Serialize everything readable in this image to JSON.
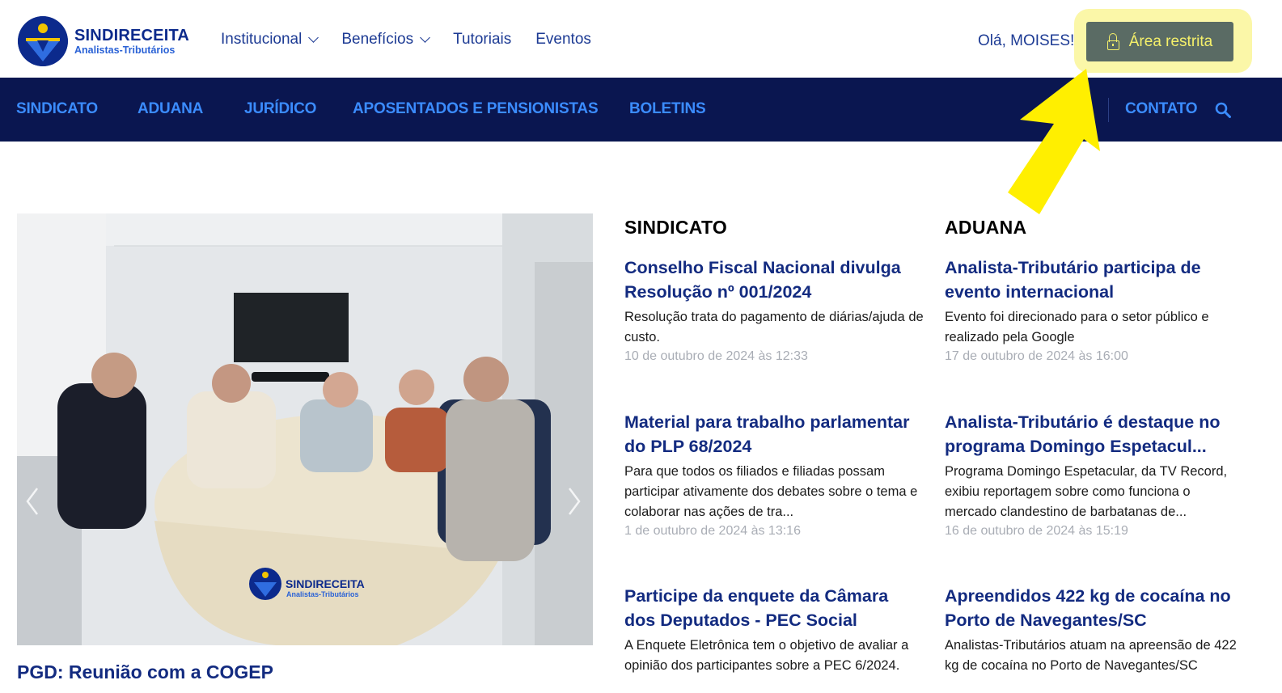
{
  "brand": {
    "name": "SINDIRECEITA",
    "tagline": "Analistas-Tributários"
  },
  "topnav": [
    {
      "label": "Institucional",
      "has_dropdown": true
    },
    {
      "label": "Benefícios",
      "has_dropdown": true
    },
    {
      "label": "Tutoriais",
      "has_dropdown": false
    },
    {
      "label": "Eventos",
      "has_dropdown": false
    }
  ],
  "user": {
    "greeting": "Olá, MOISES!",
    "restricted_label": "Área restrita"
  },
  "mainnav": [
    "SINDICATO",
    "ADUANA",
    "JURÍDICO",
    "APOSENTADOS E PENSIONISTAS",
    "BOLETINS"
  ],
  "contact_label": "CONTATO",
  "feature": {
    "title": "PGD: Reunião com a COGEP",
    "photo_brand": "SINDIRECEITA",
    "photo_tagline": "Analistas-Tributários"
  },
  "sections": [
    {
      "heading": "SINDICATO",
      "posts": [
        {
          "title": "Conselho Fiscal Nacional divulga Resolução nº 001/2024",
          "summary": "Resolução trata do pagamento de diárias/ajuda de custo.",
          "date": "10 de outubro de 2024 às 12:33"
        },
        {
          "title": "Material para trabalho parlamentar do PLP 68/2024",
          "summary": "Para que todos os filiados e filiadas possam participar ativamente dos debates sobre o tema e colaborar nas ações de tra...",
          "date": "1 de outubro de 2024 às 13:16"
        },
        {
          "title": "Participe da enquete da Câmara dos Deputados - PEC Social",
          "summary": "A Enquete Eletrônica tem o objetivo de avaliar a opinião dos participantes sobre a PEC 6/2024.",
          "date": ""
        }
      ]
    },
    {
      "heading": "ADUANA",
      "posts": [
        {
          "title": "Analista-Tributário participa de evento internacional",
          "summary": "Evento foi direcionado para o setor público e realizado pela Google",
          "date": "17 de outubro de 2024 às 16:00"
        },
        {
          "title": "Analista-Tributário é destaque no programa Domingo Espetacul...",
          "summary": "Programa Domingo Espetacular, da TV Record, exibiu reportagem sobre como funciona o mercado clandestino de barbatanas de...",
          "date": "16 de outubro de 2024 às 15:19"
        },
        {
          "title": "Apreendidos 422 kg de cocaína no Porto de Navegantes/SC",
          "summary": "Analistas-Tributários atuam na apreensão de 422 kg de cocaína no Porto de Navegantes/SC",
          "date": ""
        }
      ]
    }
  ],
  "colors": {
    "navy": "#0a1650",
    "link": "#132b80",
    "nav_link": "#3b8cff",
    "highlight": "#fbf7a8",
    "button": "#5a6b64",
    "button_text": "#f5f06a",
    "arrow": "#ffef00"
  },
  "icons": [
    "logo-icon",
    "chevron-down-icon",
    "lock-icon",
    "search-icon",
    "arrow-annotation-icon",
    "chevron-left-icon",
    "chevron-right-icon"
  ]
}
